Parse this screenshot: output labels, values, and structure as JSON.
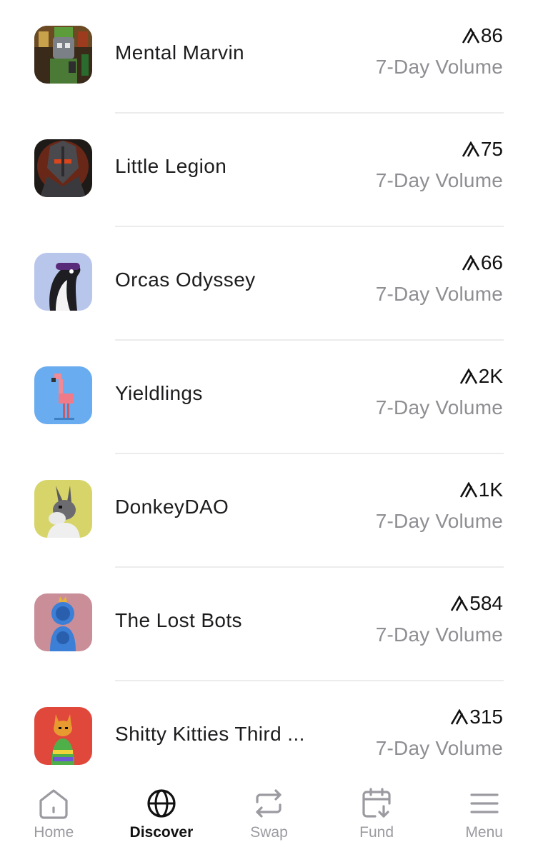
{
  "collections": [
    {
      "name": "Mental Marvin",
      "amount": "86",
      "sub": "7-Day Volume",
      "icon": "mental-marvin-thumbnail"
    },
    {
      "name": "Little Legion",
      "amount": "75",
      "sub": "7-Day Volume",
      "icon": "little-legion-thumbnail"
    },
    {
      "name": "Orcas Odyssey",
      "amount": "66",
      "sub": "7-Day Volume",
      "icon": "orcas-odyssey-thumbnail"
    },
    {
      "name": "Yieldlings",
      "amount": "2K",
      "sub": "7-Day Volume",
      "icon": "yieldlings-thumbnail"
    },
    {
      "name": "DonkeyDAO",
      "amount": "1K",
      "sub": "7-Day Volume",
      "icon": "donkeydao-thumbnail"
    },
    {
      "name": "The Lost Bots",
      "amount": "584",
      "sub": "7-Day Volume",
      "icon": "the-lost-bots-thumbnail"
    },
    {
      "name": "Shitty Kitties Third ...",
      "amount": "315",
      "sub": "7-Day Volume",
      "icon": "shitty-kitties-thumbnail"
    }
  ],
  "tabbar": {
    "home": {
      "label": "Home",
      "icon": "home-icon"
    },
    "discover": {
      "label": "Discover",
      "icon": "globe-icon"
    },
    "swap": {
      "label": "Swap",
      "icon": "swap-arrows-icon"
    },
    "fund": {
      "label": "Fund",
      "icon": "calendar-download-icon"
    },
    "menu": {
      "label": "Menu",
      "icon": "hamburger-menu-icon"
    },
    "active": "discover"
  },
  "colors": {
    "text_primary": "#1c1c1e",
    "text_secondary": "#8e8e93",
    "tab_inactive": "#9a9aa0",
    "divider": "#ececec"
  }
}
